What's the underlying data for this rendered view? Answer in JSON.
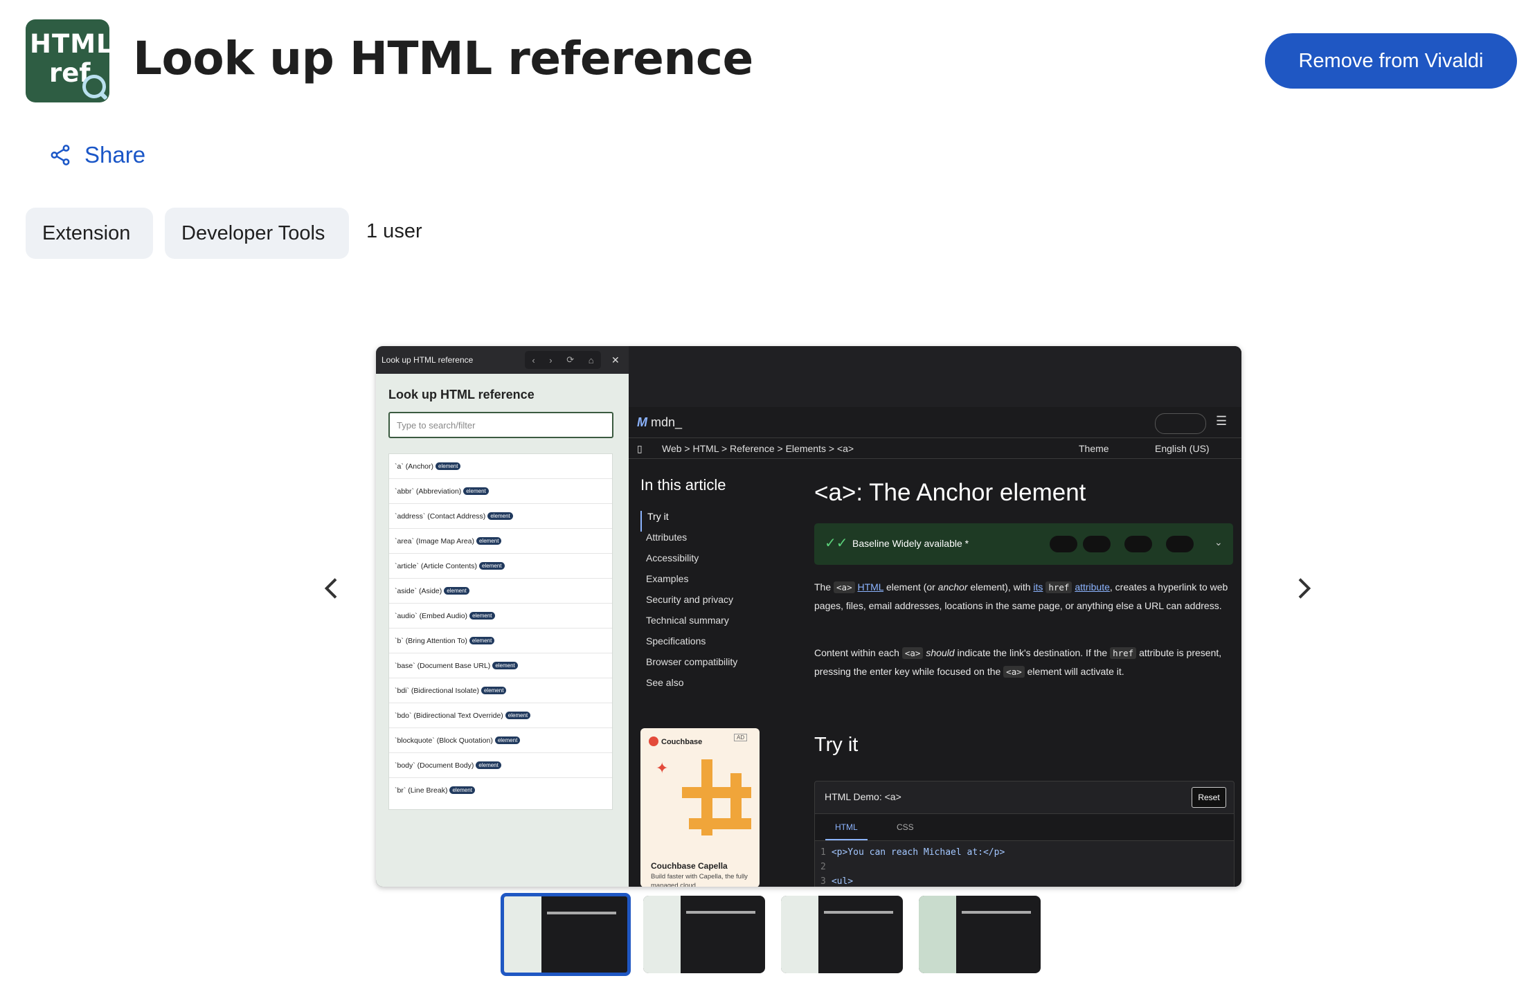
{
  "app_icon": {
    "line1": "HTML",
    "line2": "ref",
    "icon": "magnifier-icon"
  },
  "header": {
    "title": "Look up HTML reference",
    "remove_label": "Remove from Vivaldi"
  },
  "share": {
    "label": "Share",
    "icon": "share-icon"
  },
  "chips": [
    "Extension",
    "Developer Tools"
  ],
  "users": "1 user",
  "colors": {
    "accent": "#1f57c3",
    "link": "#1a56c7",
    "icon_bg": "#2e5d43",
    "chip_bg": "#eef1f5"
  },
  "screenshot": {
    "ext_window_title": "Look up HTML reference",
    "ext_heading": "Look up HTML reference",
    "ext_search_placeholder": "Type to search/filter",
    "badge": "element",
    "ext_items": [
      "`a` (Anchor)",
      "`abbr` (Abbreviation)",
      "`address` (Contact Address)",
      "`area` (Image Map Area)",
      "`article` (Article Contents)",
      "`aside` (Aside)",
      "`audio` (Embed Audio)",
      "`b` (Bring Attention To)",
      "`base` (Document Base URL)",
      "`bdi` (Bidirectional Isolate)",
      "`bdo` (Bidirectional Text Override)",
      "`blockquote` (Block Quotation)",
      "`body` (Document Body)",
      "`br` (Line Break)"
    ],
    "mdn_logo": "mdn_",
    "breadcrumbs": "Web  >  HTML  >  Reference  >  Elements  >  <a>",
    "theme": "Theme",
    "language": "English (US)",
    "toc_heading": "In this article",
    "toc": [
      "Try it",
      "Attributes",
      "Accessibility",
      "Examples",
      "Security and privacy",
      "Technical summary",
      "Specifications",
      "Browser compatibility",
      "See also"
    ],
    "ad": {
      "brand": "Couchbase",
      "label": "AD",
      "title": "Couchbase Capella",
      "sub": "Build faster with Capella, the fully managed cloud"
    },
    "article_title": "<a>: The Anchor element",
    "baseline": "Baseline Widely available *",
    "try_heading": "Try it",
    "demo_title": "HTML Demo: <a>",
    "reset": "Reset",
    "tab_html": "HTML",
    "tab_css": "CSS",
    "code_lines": [
      "<p>You can reach Michael at:</p>",
      "",
      "<ul>"
    ]
  }
}
